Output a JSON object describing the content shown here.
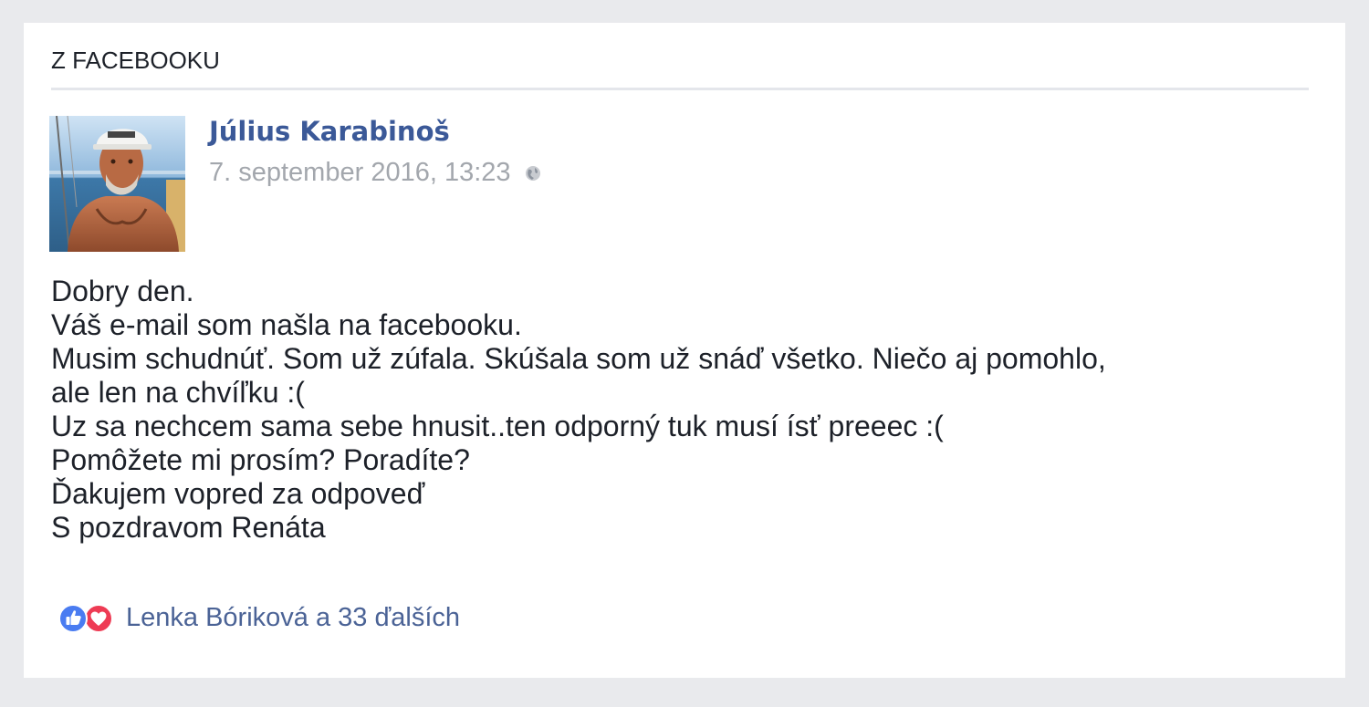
{
  "section": {
    "title": "Z FACEBOOKU"
  },
  "post": {
    "author": "Július Karabinoš",
    "timestamp": "7. september 2016, 13:23",
    "privacy_icon": "globe-icon",
    "lines": [
      "Dobry den.",
      "Váš e-mail som našla na facebooku.",
      "Musim schudnúť. Som už zúfala. Skúšala som už snáď všetko. Niečo aj pomohlo,",
      "ale len na chvíľku :(",
      "Uz sa nechcem sama sebe hnusit..ten odporný tuk musí ísť preeec :(",
      "Pomôžete mi prosím? Poradíte?",
      "Ďakujem vopred za odpoveď",
      "S pozdravom Renáta"
    ],
    "reactions": {
      "icons": [
        "like-icon",
        "love-icon"
      ],
      "text": "Lenka Bóriková a 33 ďalších"
    }
  },
  "colors": {
    "background": "#e9eaed",
    "card": "#ffffff",
    "author_link": "#3b5998",
    "timestamp": "#a3a7ad",
    "like": "#4a7cf1",
    "love": "#ee3b54"
  }
}
